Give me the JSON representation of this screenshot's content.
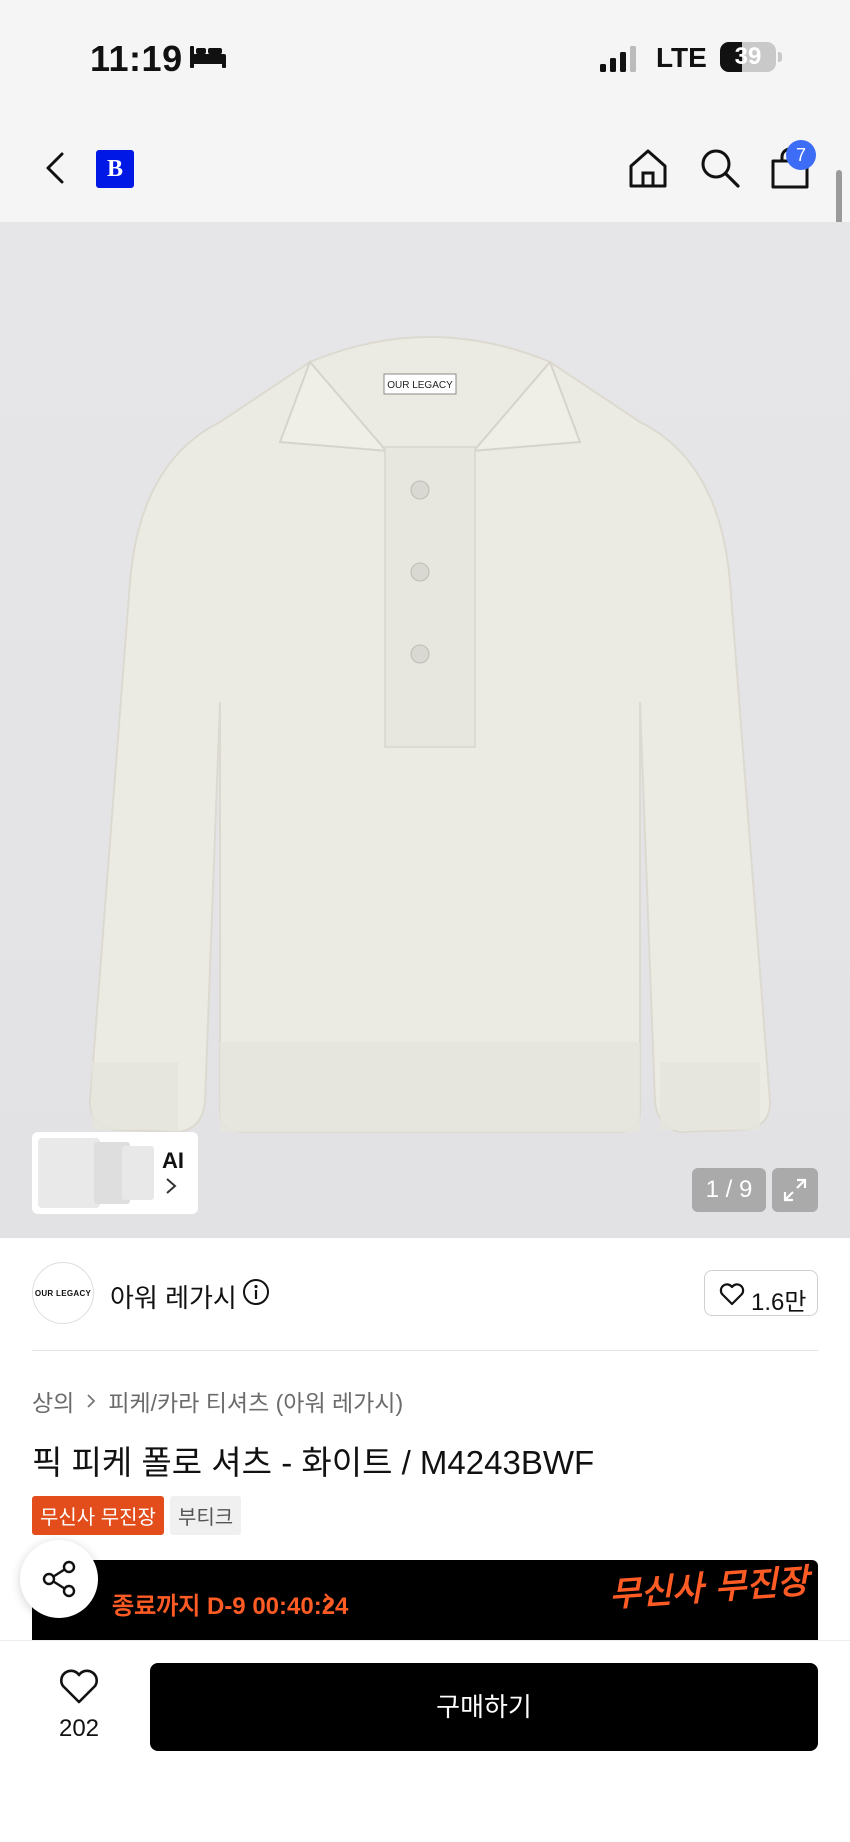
{
  "status_bar": {
    "time": "11:19",
    "network": "LTE",
    "battery": "39",
    "battery_level": 0.39
  },
  "header": {
    "brand_logo": "B",
    "cart_count": "7",
    "icons": [
      "back-icon",
      "home-icon",
      "search-icon",
      "bag-icon"
    ]
  },
  "gallery": {
    "shirt_label": "OUR LEGACY",
    "ai_label": "AI",
    "page_indicator": "1 / 9"
  },
  "brand": {
    "avatar_text": "OUR LEGACY",
    "name": "아워 레가시",
    "likes": "1.6만"
  },
  "product": {
    "breadcrumb": [
      "상의",
      "피케/카라 티셔츠 (아워 레가시)"
    ],
    "title": "픽 피케 폴로 셔츠 - 화이트 / M4243BWF",
    "tags": [
      "무신사 무진장",
      "부티크"
    ]
  },
  "promo": {
    "countdown": "종료까지 D-9 00:40:24",
    "logo_text": "무신사 무진장"
  },
  "bottom_bar": {
    "wish_count": "202",
    "buy_label": "구매하기"
  },
  "colors": {
    "accent_orange": "#e24d1b",
    "brand_blue": "#0018e6",
    "badge_blue": "#3d6df6"
  }
}
